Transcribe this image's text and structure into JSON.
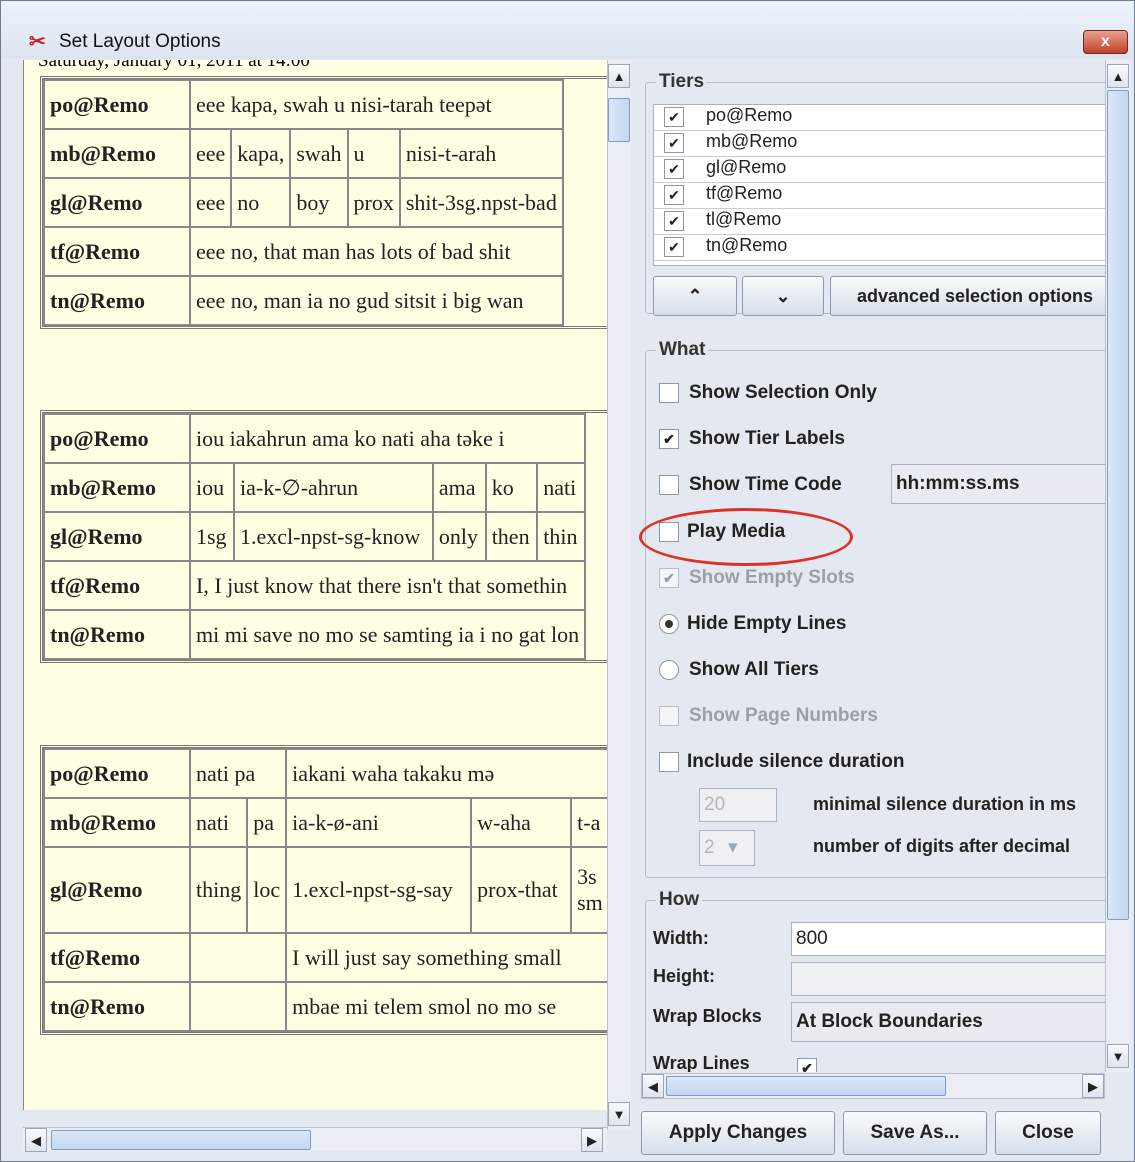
{
  "window": {
    "title": "Set Layout Options",
    "close_glyph": "x"
  },
  "preview": {
    "header_text": "Saturday, January 01, 2011 at 14:00",
    "blocks": [
      {
        "rows": [
          {
            "label": "po@Remo",
            "cells": [
              "eee kapa, swah u nisi-tarah teepət"
            ]
          },
          {
            "label": "mb@Remo",
            "cells": [
              "eee",
              "kapa,",
              "swah",
              "u",
              "nisi-t-arah"
            ]
          },
          {
            "label": "gl@Remo",
            "cells": [
              "eee",
              "no",
              "boy",
              "prox",
              "shit-3sg.npst-bad"
            ]
          },
          {
            "label": "tf@Remo",
            "cells": [
              "eee no, that man has lots of bad shit"
            ]
          },
          {
            "label": "tn@Remo",
            "cells": [
              "eee no, man ia no gud sitsit i big wan"
            ]
          }
        ]
      },
      {
        "rows": [
          {
            "label": "po@Remo",
            "cells": [
              "iou iakahrun ama ko nati aha təke i"
            ]
          },
          {
            "label": "mb@Remo",
            "cells": [
              "iou",
              "ia-k-∅-ahrun",
              "ama",
              "ko",
              "nati"
            ]
          },
          {
            "label": "gl@Remo",
            "cells": [
              "1sg",
              "1.excl-npst-sg-know",
              "only",
              "then",
              "thin"
            ]
          },
          {
            "label": "tf@Remo",
            "cells": [
              "I, I just know that there isn't that somethin"
            ]
          },
          {
            "label": "tn@Remo",
            "cells": [
              "mi mi save no mo se samting ia i no gat lon"
            ]
          }
        ]
      },
      {
        "rows": [
          {
            "label": "po@Remo",
            "cells": [
              "nati pa",
              "iakani waha takaku mə"
            ]
          },
          {
            "label": "mb@Remo",
            "cells": [
              "nati",
              "pa",
              "ia-k-ø-ani",
              "w-aha",
              "t-a"
            ]
          },
          {
            "label": "gl@Remo",
            "cells": [
              "thing",
              "loc",
              "1.excl-npst-sg-say",
              "prox-that",
              "3s sm"
            ]
          },
          {
            "label": "tf@Remo",
            "cells": [
              "",
              "I will just say something small"
            ]
          },
          {
            "label": "tn@Remo",
            "cells": [
              "",
              "mbae mi telem smol no mo se"
            ]
          }
        ]
      }
    ]
  },
  "options": {
    "tiers": {
      "title": "Tiers",
      "items": [
        "po@Remo",
        "mb@Remo",
        "gl@Remo",
        "tf@Remo",
        "tl@Remo",
        "tn@Remo"
      ],
      "up_glyph": "⌃",
      "down_glyph": "⌄",
      "advanced_label": "advanced selection options"
    },
    "what": {
      "title": "What",
      "show_selection_only": "Show Selection Only",
      "show_tier_labels": "Show Tier Labels",
      "show_time_code": "Show Time Code",
      "time_format": "hh:mm:ss.ms",
      "play_media": "Play Media",
      "show_empty_slots": "Show Empty Slots",
      "hide_empty_lines": "Hide Empty Lines",
      "show_all_tiers": "Show All Tiers",
      "show_page_numbers": "Show Page Numbers",
      "include_silence": "Include silence duration",
      "min_silence_value": "20",
      "min_silence_label": "minimal silence duration in ms",
      "digits_value": "2",
      "digits_label": "number of digits after decimal"
    },
    "how": {
      "title": "How",
      "width_label": "Width:",
      "width_value": "800",
      "height_label": "Height:",
      "wrap_blocks_label": "Wrap Blocks",
      "wrap_blocks_value": "At Block Boundaries",
      "wrap_lines_label": "Wrap Lines"
    }
  },
  "buttons": {
    "apply": "Apply Changes",
    "save_as": "Save As...",
    "close": "Close"
  },
  "colors": {
    "preview_bg": "#ffffe3",
    "highlight_circle": "#e0302a"
  }
}
